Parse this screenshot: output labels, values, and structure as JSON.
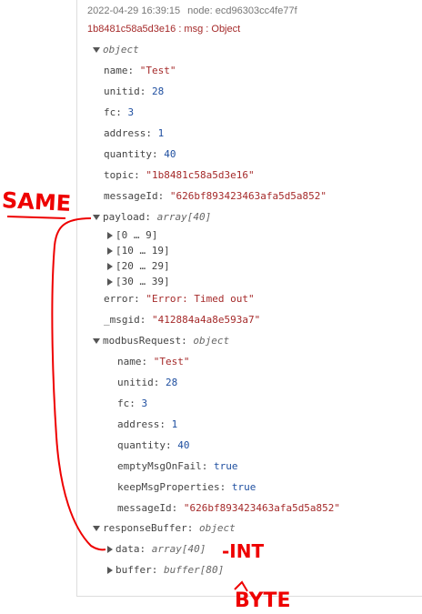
{
  "header": {
    "timestamp": "2022-04-29 16:39:15",
    "node": "node: ecd96303cc4fe77f",
    "topic_line": "1b8481c58a5d3e16 : msg : Object"
  },
  "tree": {
    "root_type": "object",
    "fields": [
      {
        "key": "name",
        "value": "\"Test\"",
        "kind": "str"
      },
      {
        "key": "unitid",
        "value": "28",
        "kind": "num"
      },
      {
        "key": "fc",
        "value": "3",
        "kind": "num"
      },
      {
        "key": "address",
        "value": "1",
        "kind": "num"
      },
      {
        "key": "quantity",
        "value": "40",
        "kind": "num"
      },
      {
        "key": "topic",
        "value": "\"1b8481c58a5d3e16\"",
        "kind": "str"
      },
      {
        "key": "messageId",
        "value": "\"626bf893423463afa5d5a852\"",
        "kind": "str"
      }
    ],
    "payload": {
      "key": "payload",
      "type": "array[40]",
      "ranges": [
        "[0 … 9]",
        "[10 … 19]",
        "[20 … 29]",
        "[30 … 39]"
      ]
    },
    "error": {
      "key": "error",
      "value": "\"Error: Timed out\""
    },
    "msgid": {
      "key": "_msgid",
      "value": "\"412884a4a8e593a7\""
    },
    "modbusRequest": {
      "key": "modbusRequest",
      "type": "object",
      "fields": [
        {
          "key": "name",
          "value": "\"Test\"",
          "kind": "str"
        },
        {
          "key": "unitid",
          "value": "28",
          "kind": "num"
        },
        {
          "key": "fc",
          "value": "3",
          "kind": "num"
        },
        {
          "key": "address",
          "value": "1",
          "kind": "num"
        },
        {
          "key": "quantity",
          "value": "40",
          "kind": "num"
        },
        {
          "key": "emptyMsgOnFail",
          "value": "true",
          "kind": "bool"
        },
        {
          "key": "keepMsgProperties",
          "value": "true",
          "kind": "bool"
        },
        {
          "key": "messageId",
          "value": "\"626bf893423463afa5d5a852\"",
          "kind": "str"
        }
      ]
    },
    "responseBuffer": {
      "key": "responseBuffer",
      "type": "object",
      "data": {
        "key": "data",
        "type": "array[40]"
      },
      "buffer": {
        "key": "buffer",
        "type": "buffer[80]"
      }
    }
  },
  "annotations": {
    "same": "SAME",
    "int": "-INT",
    "byte": "BYTE",
    "color": "#e00000"
  }
}
